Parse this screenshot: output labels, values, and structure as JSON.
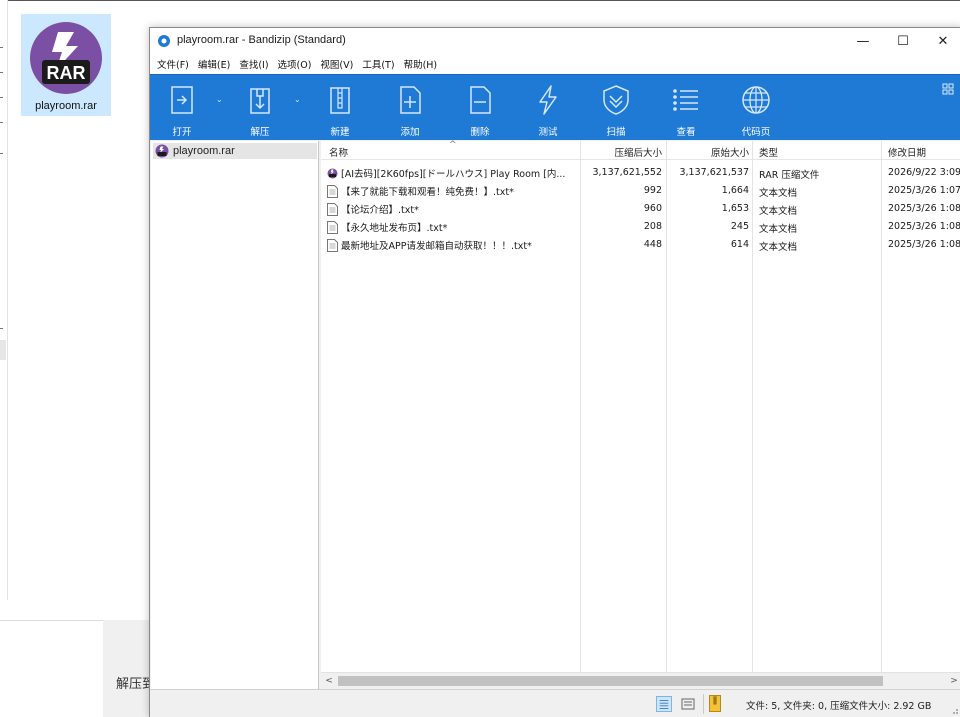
{
  "colors": {
    "toolbar_bg": "#1f7ad6",
    "rar_badge": "#7b4fa3",
    "selection": "#cce8ff"
  },
  "desktop": {
    "file_label": "playroom.rar",
    "badge_text": "RAR",
    "under_label": "解压到"
  },
  "window": {
    "title": "playroom.rar - Bandizip (Standard)",
    "controls": {
      "minimize": "—",
      "maximize": "☐",
      "close": "✕"
    }
  },
  "menu": [
    {
      "label": "文件(F)"
    },
    {
      "label": "编辑(E)"
    },
    {
      "label": "查找(I)"
    },
    {
      "label": "选项(O)"
    },
    {
      "label": "视图(V)"
    },
    {
      "label": "工具(T)"
    },
    {
      "label": "帮助(H)"
    }
  ],
  "toolbar": {
    "open": "打开",
    "extract": "解压",
    "new": "新建",
    "add": "添加",
    "delete": "删除",
    "test": "测试",
    "scan": "扫描",
    "view": "查看",
    "codepage": "代码页",
    "dropdown": "⌄"
  },
  "tree": {
    "root": "playroom.rar"
  },
  "list": {
    "columns": {
      "name": "名称",
      "packed": "压缩后大小",
      "original": "原始大小",
      "type": "类型",
      "modified": "修改日期"
    },
    "sort_indicator": "^",
    "rows": [
      {
        "name": "[AI去码][2K60fps][ドールハウス] Play Room [内...",
        "packed": "3,137,621,552",
        "original": "3,137,621,537",
        "type": "RAR 压缩文件",
        "modified": "2026/9/22 3:09",
        "icon": "rar-file-icon"
      },
      {
        "name": "【来了就能下载和观看！纯免费！】.txt*",
        "packed": "992",
        "original": "1,664",
        "type": "文本文档",
        "modified": "2025/3/26 1:07",
        "icon": "text-file-icon"
      },
      {
        "name": "【论坛介绍】.txt*",
        "packed": "960",
        "original": "1,653",
        "type": "文本文档",
        "modified": "2025/3/26 1:08",
        "icon": "text-file-icon"
      },
      {
        "name": "【永久地址发布页】.txt*",
        "packed": "208",
        "original": "245",
        "type": "文本文档",
        "modified": "2025/3/26 1:08",
        "icon": "text-file-icon"
      },
      {
        "name": "最新地址及APP请发邮箱自动获取！！！.txt*",
        "packed": "448",
        "original": "614",
        "type": "文本文档",
        "modified": "2025/3/26 1:08",
        "icon": "text-file-icon"
      }
    ]
  },
  "scrollbar": {
    "left": "<",
    "right": ">"
  },
  "status": {
    "text": "文件: 5, 文件夹: 0, 压缩文件大小: 2.92 GB"
  }
}
